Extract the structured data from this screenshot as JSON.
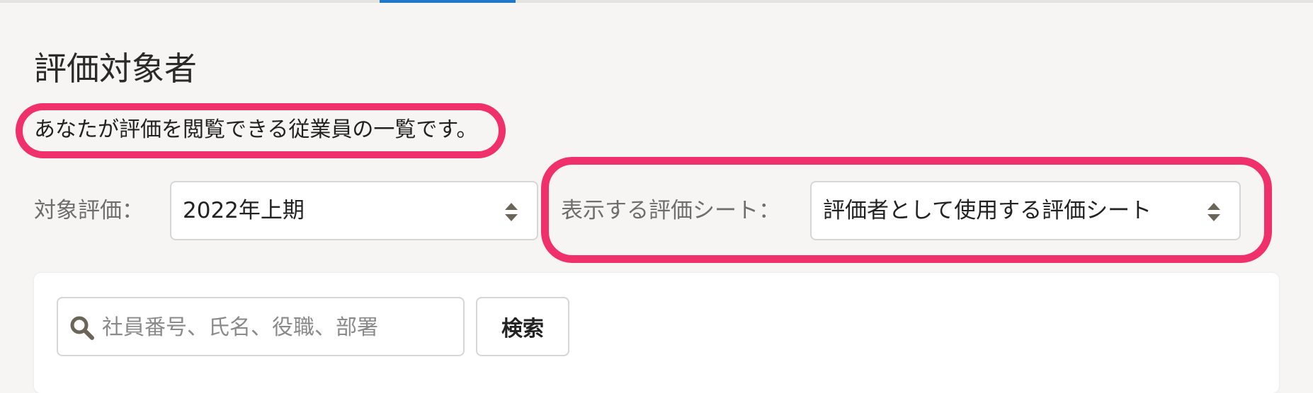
{
  "page": {
    "title": "評価対象者",
    "description": "あなたが評価を閲覧できる従業員の一覧です。"
  },
  "filters": {
    "target_evaluation": {
      "label": "対象評価：",
      "value": "2022年上期"
    },
    "display_sheet": {
      "label": "表示する評価シート：",
      "value": "評価者として使用する評価シート"
    }
  },
  "search": {
    "placeholder": "社員番号、氏名、役職、部署",
    "button_label": "検索"
  },
  "colors": {
    "highlight": "#f0306a",
    "tab_indicator": "#2177c9",
    "background": "#f6f5f3"
  },
  "icons": [
    "search-icon",
    "select-arrows-icon"
  ]
}
